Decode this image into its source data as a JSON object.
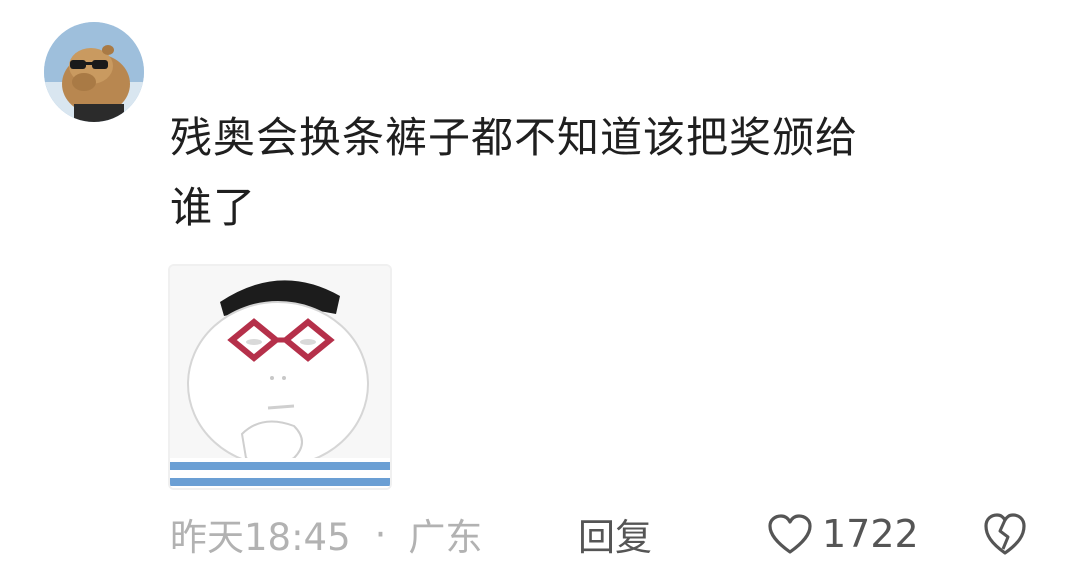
{
  "comment": {
    "text_line1": "残奥会换条裤子都不知道该把奖颁给",
    "text_line2": "谁了",
    "time": "昨天18:45",
    "separator": "·",
    "location": "广东",
    "reply_label": "回复",
    "like_count": "1722"
  },
  "icons": {
    "avatar": "capybara-with-sunglasses-avatar",
    "sticker": "cartoon-face-with-red-glasses-sticker",
    "like": "heart-outline-icon",
    "dislike": "broken-heart-icon"
  },
  "colors": {
    "text_primary": "#1f1f1f",
    "text_meta": "#b2b2b2",
    "text_action": "#555555",
    "sticker_glasses": "#b5304a"
  }
}
